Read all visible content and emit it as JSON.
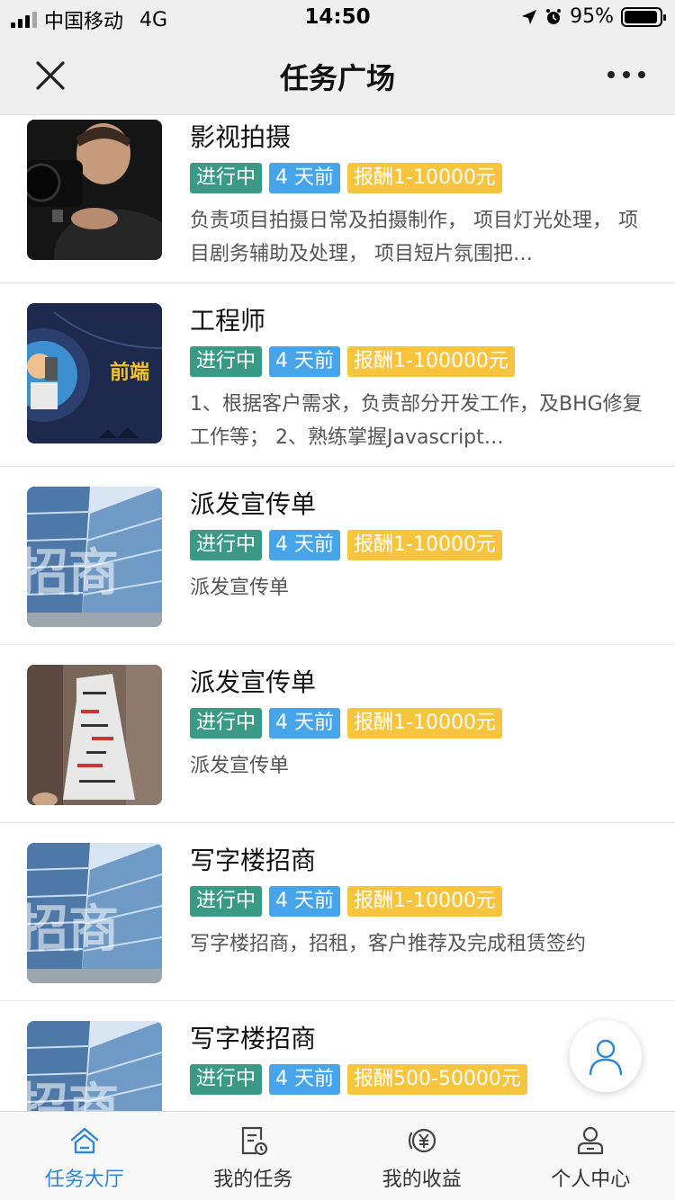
{
  "status_bar": {
    "carrier": "中国移动",
    "network": "4G",
    "time": "14:50",
    "battery": "95%"
  },
  "nav": {
    "title": "任务广场"
  },
  "tasks": [
    {
      "name": "影视拍摄",
      "status": "进行中",
      "posted": "4 天前",
      "pay": "报酬1-10000元",
      "desc": "负责项目拍摄日常及拍摄制作， 项目灯光处理， 项目剧务辅助及处理， 项目短片氛围把…",
      "thumb": "photographer"
    },
    {
      "name": "工程师",
      "status": "进行中",
      "posted": "4 天前",
      "pay": "报酬1-100000元",
      "desc": "1、根据客户需求，负责部分开发工作，及BHG修复工作等； 2、熟练掌握Javascript…",
      "thumb": "frontend-banner",
      "thumb_text": "前端"
    },
    {
      "name": "派发宣传单",
      "status": "进行中",
      "posted": "4 天前",
      "pay": "报酬1-10000元",
      "desc": "派发宣传单",
      "thumb": "office-building",
      "thumb_text": "招商"
    },
    {
      "name": "派发宣传单",
      "status": "进行中",
      "posted": "4 天前",
      "pay": "报酬1-10000元",
      "desc": "派发宣传单",
      "thumb": "newspaper-costume"
    },
    {
      "name": "写字楼招商",
      "status": "进行中",
      "posted": "4 天前",
      "pay": "报酬1-10000元",
      "desc": "写字楼招商，招租，客户推荐及完成租赁签约",
      "thumb": "office-building",
      "thumb_text": "招商"
    },
    {
      "name": "写字楼招商",
      "status": "进行中",
      "posted": "4 天前",
      "pay": "报酬500-50000元",
      "desc": "",
      "thumb": "office-building",
      "thumb_text": "招商"
    }
  ],
  "tab_bar": {
    "items": [
      {
        "label": "任务大厅",
        "icon": "home-icon",
        "active": true
      },
      {
        "label": "我的任务",
        "icon": "task-list-icon",
        "active": false
      },
      {
        "label": "我的收益",
        "icon": "earnings-icon",
        "active": false
      },
      {
        "label": "个人中心",
        "icon": "profile-icon",
        "active": false
      }
    ]
  },
  "colors": {
    "accent": "#2f86d6",
    "status_tag": "#3a9a86",
    "time_tag": "#45a4ea",
    "pay_tag": "#f7c43d"
  }
}
